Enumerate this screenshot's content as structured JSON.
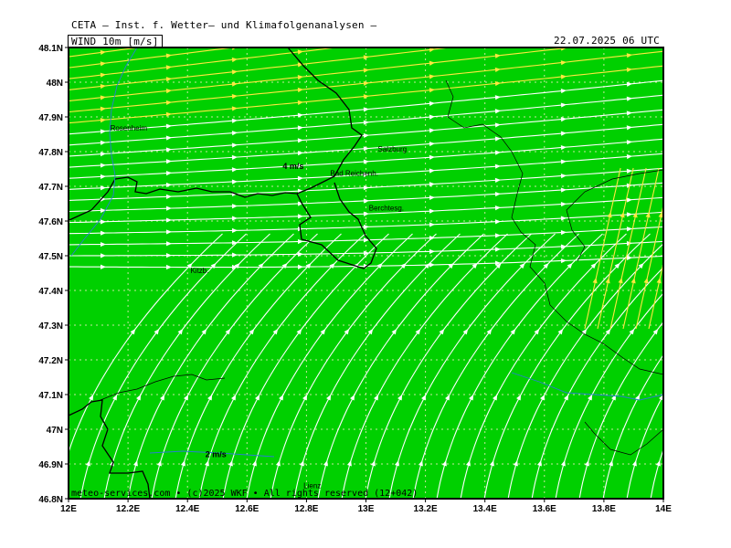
{
  "header": {
    "title": "CETA – Inst. f. Wetter– und Klimafolgenanalysen –",
    "field_label": "WIND_10m_[m/s]",
    "valid_time": "22.07.2025 06 UTC"
  },
  "footer": {
    "copyright": "meteo-services.com • (c)2025 WKF • All rights reserved (12+042)"
  },
  "colors": {
    "map_fill": "#00d000",
    "streamline_white": "#ffffff",
    "streamline_yellow": "#ffe840",
    "border": "#000000",
    "river": "#2a7fd0",
    "grid_dots": "#c9e8a0"
  },
  "axes": {
    "lon_range": [
      12.0,
      14.0
    ],
    "lat_range": [
      46.8,
      48.1
    ],
    "lon_ticks": [
      "12E",
      "12.2E",
      "12.4E",
      "12.6E",
      "12.8E",
      "13E",
      "13.2E",
      "13.4E",
      "13.6E",
      "13.8E",
      "14E"
    ],
    "lat_ticks": [
      "48.1N",
      "48N",
      "47.9N",
      "47.8N",
      "47.7N",
      "47.6N",
      "47.5N",
      "47.4N",
      "47.3N",
      "47.2N",
      "47.1N",
      "47N",
      "46.9N",
      "46.8N"
    ]
  },
  "places": [
    {
      "name": "Rosenheim",
      "lon": 12.14,
      "lat": 47.86
    },
    {
      "name": "Salzburg",
      "lon": 13.04,
      "lat": 47.8
    },
    {
      "name": "Bad Reichenh.",
      "lon": 12.88,
      "lat": 47.73
    },
    {
      "name": "Berchtesg.",
      "lon": 13.01,
      "lat": 47.63
    },
    {
      "name": "Kitzb.",
      "lon": 12.41,
      "lat": 47.45
    },
    {
      "name": "Lienz",
      "lon": 12.79,
      "lat": 46.83
    }
  ],
  "wind_labels": [
    {
      "text": "4 m/s",
      "lon": 12.72,
      "lat": 47.75
    },
    {
      "text": "2 m/s",
      "lon": 12.46,
      "lat": 46.92
    }
  ]
}
